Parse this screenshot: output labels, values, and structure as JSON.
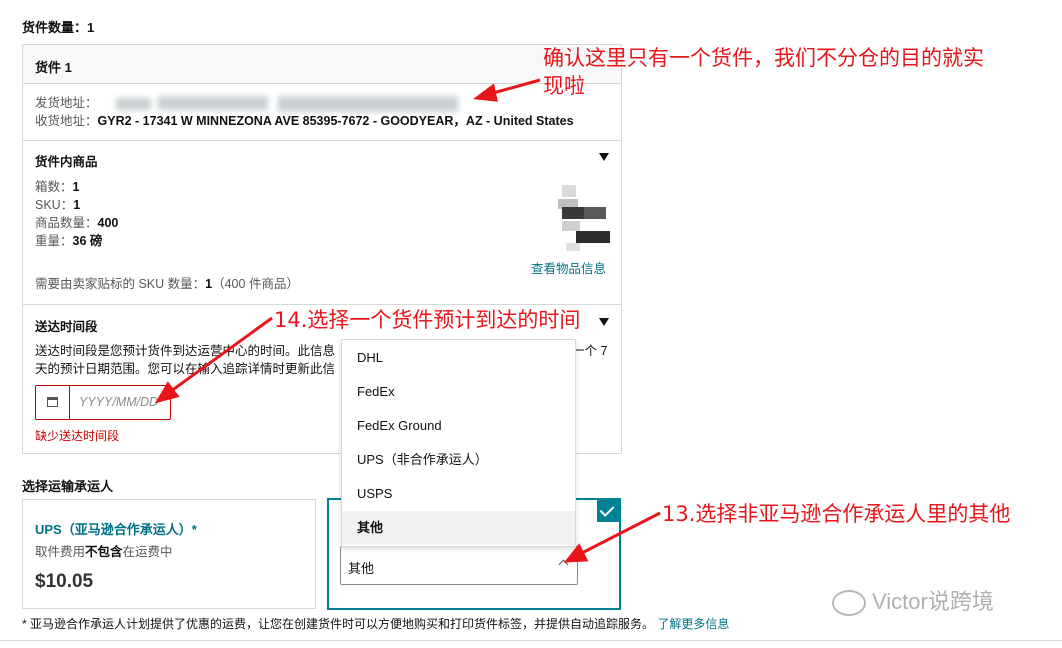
{
  "shipment_count": {
    "label": "货件数量：",
    "value": "1"
  },
  "shipment": {
    "title": "货件 1",
    "ship_from_label": "发货地址：",
    "ship_to_label": "收货地址：",
    "ship_to_value": "GYR2 - 17341 W MINNEZONA AVE 85395-7672 - GOODYEAR，AZ - United States"
  },
  "contents": {
    "title": "货件内商品",
    "boxes_label": "箱数：",
    "boxes": "1",
    "sku_label": "SKU：",
    "sku": "1",
    "units_label": "商品数量：",
    "units": "400",
    "weight_label": "重量：",
    "weight": "36 磅",
    "view_link": "查看物品信息",
    "label_note_prefix": "需要由卖家贴标的 SKU 数量：",
    "label_note_count": "1",
    "label_note_suffix": "（400 件商品）"
  },
  "delivery": {
    "title": "送达时间段",
    "desc_line1_a": "送达时间段是您预计货件到",
    "desc_line1_b": "达运营中心的时间。此信息",
    "desc_line1_end": "一个 7",
    "desc_line2_a": "天的预计日期范围。您",
    "desc_line2_b": "可以在输入追踪详情时更新此信",
    "date_placeholder": "YYYY/MM/DD",
    "error": "缺少送达时间段"
  },
  "carrier": {
    "title": "选择运输承运人",
    "ups_partner": {
      "title": "UPS（亚马逊合作承运人）*",
      "fee_prefix": "取件费用",
      "fee_bold": "不包含",
      "fee_suffix": "在运费中",
      "price": "$10.05"
    },
    "dropdown": {
      "options": [
        "DHL",
        "FedEx",
        "FedEx Ground",
        "UPS（非合作承运人）",
        "USPS",
        "其他"
      ],
      "selected": "其他"
    },
    "footnote": "* 亚马逊合作承运人计划提供了优惠的运费，让您在创建货件时可以方便地购买和打印货件标签，并提供自动追踪服务。",
    "learn_more": "了解更多信息"
  },
  "annotations": {
    "a1_line1": "确认这里只有一个货件，我们不分仓的目的就实",
    "a1_line2": "现啦",
    "a14": "14.选择一个货件预计到达的时间",
    "a13": "13.选择非亚马逊合作承运人里的其他"
  },
  "watermark": "Victor说跨境",
  "colors": {
    "accent": "#007185",
    "error": "#c40000",
    "annotation": "#e8161b",
    "selected_border": "#008296"
  }
}
